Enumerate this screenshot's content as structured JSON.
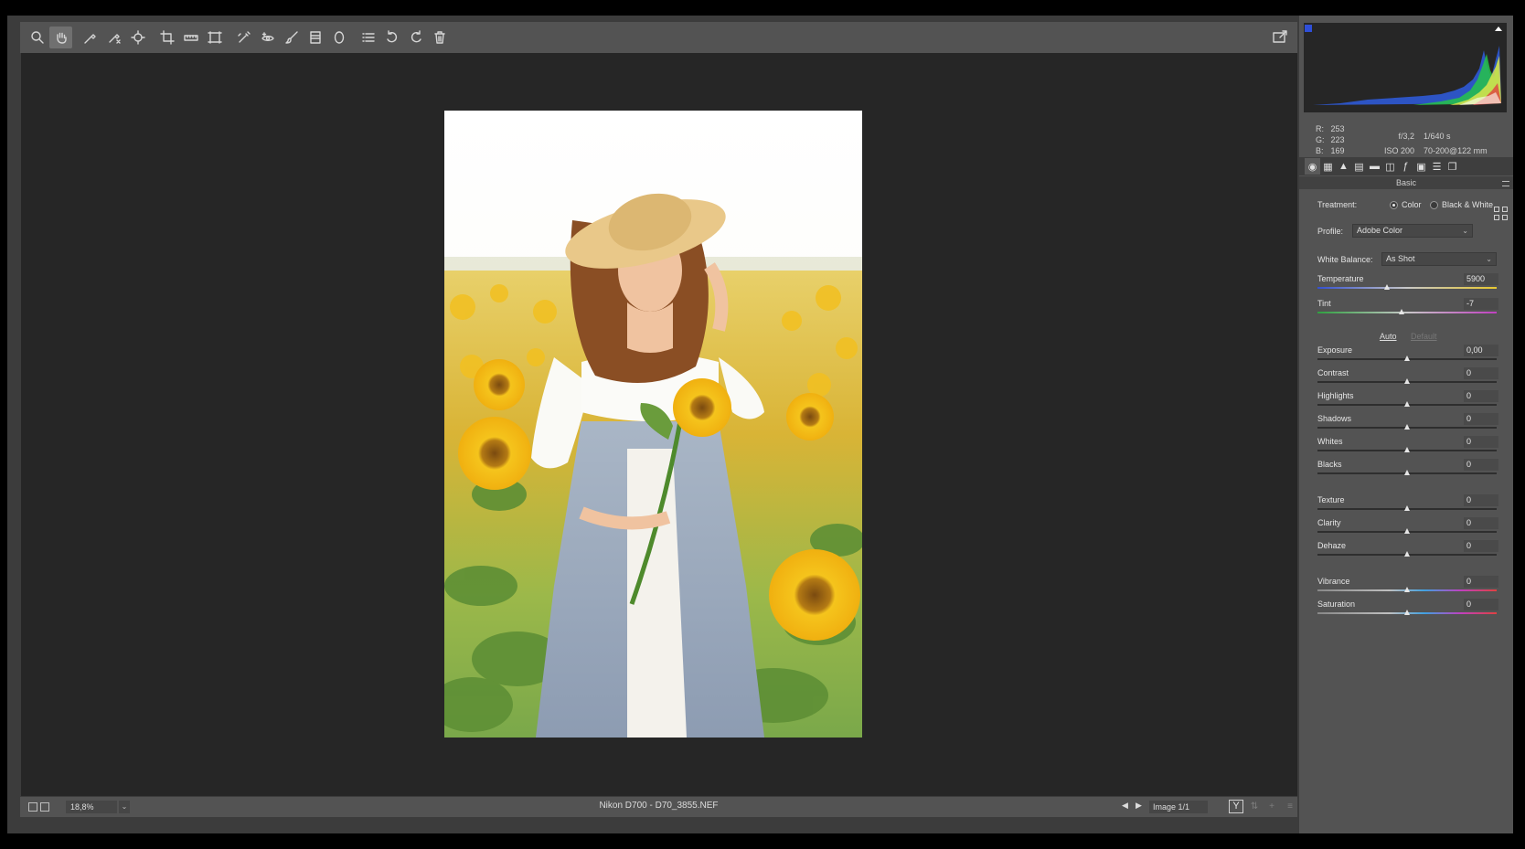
{
  "toolbar": {
    "tools": [
      {
        "name": "zoom-tool",
        "icon": "magnifier-icon"
      },
      {
        "name": "hand-tool",
        "icon": "hand-icon",
        "active": true
      },
      {
        "name": "white-balance-tool",
        "icon": "eyedropper-icon"
      },
      {
        "name": "color-sampler-tool",
        "icon": "sampler-icon"
      },
      {
        "name": "targeted-adjustment-tool",
        "icon": "target-icon"
      },
      {
        "name": "crop-tool",
        "icon": "crop-icon"
      },
      {
        "name": "straighten-tool",
        "icon": "ruler-icon"
      },
      {
        "name": "transform-tool",
        "icon": "transform-icon"
      },
      {
        "name": "spot-removal-tool",
        "icon": "brush-heal-icon"
      },
      {
        "name": "red-eye-tool",
        "icon": "eye-icon"
      },
      {
        "name": "adjustment-brush-tool",
        "icon": "brush-icon"
      },
      {
        "name": "graduated-filter-tool",
        "icon": "gradient-icon"
      },
      {
        "name": "radial-filter-tool",
        "icon": "ellipse-icon"
      },
      {
        "name": "preferences-tool",
        "icon": "list-icon"
      },
      {
        "name": "rotate-ccw-tool",
        "icon": "rotate-ccw-icon"
      },
      {
        "name": "rotate-cw-tool",
        "icon": "rotate-cw-icon"
      },
      {
        "name": "trash-tool",
        "icon": "trash-icon"
      }
    ],
    "open_icon": "full-screen-icon"
  },
  "bottombar": {
    "zoom_value": "18,8%",
    "filename": "Nikon D700  -  D70_3855.NEF",
    "image_count": "Image 1/1",
    "y_button": "Y"
  },
  "readout": {
    "r_label": "R:",
    "r": "253",
    "g_label": "G:",
    "g": "223",
    "b_label": "B:",
    "b": "169",
    "aperture": "f/3,2",
    "shutter": "1/640 s",
    "iso": "ISO 200",
    "lens": "70-200@122 mm"
  },
  "panel": {
    "title": "Basic",
    "treatment_label": "Treatment:",
    "treatment_color": "Color",
    "treatment_bw": "Black & White",
    "profile_label": "Profile:",
    "profile_value": "Adobe Color",
    "wb_label": "White Balance:",
    "wb_value": "As Shot",
    "auto": "Auto",
    "default": "Default"
  },
  "sliders": [
    {
      "key": "temperature",
      "name": "Temperature",
      "value": "5900",
      "pos": 0.39
    },
    {
      "key": "tint",
      "name": "Tint",
      "value": "-7",
      "pos": 0.47
    },
    {
      "key": "exposure",
      "name": "Exposure",
      "value": "0,00",
      "pos": 0.5
    },
    {
      "key": "contrast",
      "name": "Contrast",
      "value": "0",
      "pos": 0.5
    },
    {
      "key": "highlights",
      "name": "Highlights",
      "value": "0",
      "pos": 0.5
    },
    {
      "key": "shadows",
      "name": "Shadows",
      "value": "0",
      "pos": 0.5
    },
    {
      "key": "whites",
      "name": "Whites",
      "value": "0",
      "pos": 0.5
    },
    {
      "key": "blacks",
      "name": "Blacks",
      "value": "0",
      "pos": 0.5
    },
    {
      "key": "texture",
      "name": "Texture",
      "value": "0",
      "pos": 0.5
    },
    {
      "key": "clarity",
      "name": "Clarity",
      "value": "0",
      "pos": 0.5
    },
    {
      "key": "dehaze",
      "name": "Dehaze",
      "value": "0",
      "pos": 0.5
    },
    {
      "key": "vibrance",
      "name": "Vibrance",
      "value": "0",
      "pos": 0.5
    },
    {
      "key": "saturation",
      "name": "Saturation",
      "value": "0",
      "pos": 0.5
    }
  ],
  "colors": {
    "workspace": "#262626",
    "chrome": "#535353",
    "accent_blue": "#2f4fd8"
  }
}
